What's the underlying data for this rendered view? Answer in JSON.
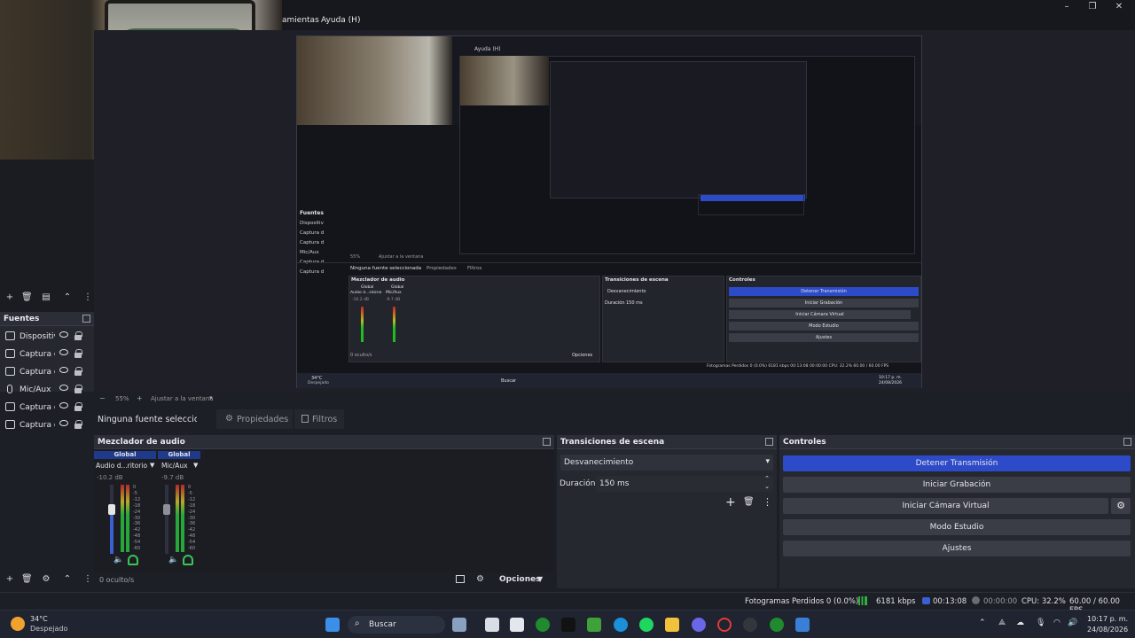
{
  "menu": {
    "herramientas": "amientas",
    "ayuda": "Ayuda (H)"
  },
  "nested": {
    "menu_ayuda": "Ayuda (H)",
    "fuentes_title": "Fuentes",
    "sources": [
      "Dispositiv",
      "Captura d",
      "Captura d",
      "Mic/Aux",
      "Captura d",
      "Captura d"
    ],
    "ninguna": "Ninguna fuente seleccionada",
    "propiedades": "Propiedades",
    "filtros": "Filtros",
    "mezclador": "Mezclador de audio",
    "transiciones": "Transiciones de escena",
    "controles": "Controles",
    "global1": "Global",
    "global2": "Global",
    "ch1": "Audio d...sitorio",
    "ch2": "Mic/Aux",
    "db1": "-10.2 dB",
    "db2": "-9.7 dB",
    "desvanecimiento": "Desvanecimiento",
    "duracion": "Duración",
    "duracion_value": "150 ms",
    "detener": "Detener Transmisión",
    "iniciar_grab": "Iniciar Grabación",
    "camara_virtual": "Iniciar Cámara Virtual",
    "modo_estudio": "Modo Estudio",
    "ajustes": "Ajustes",
    "ocultos": "0 oculto/s",
    "opciones": "Opciones",
    "zoom": "55%",
    "ajustar": "Ajustar a la ventana",
    "status": "Fotogramas Perdidos 0 (0.0%)   6181 kbps   00:13:08   00:00:00   CPU: 32.2%   60.00 / 60.00 FPS",
    "weather": "34°C",
    "weather_desc": "Despejado",
    "buscar": "Buscar",
    "clock": "10:17 p. m.",
    "date": "24/08/2026"
  },
  "sources_panel": {
    "title": "Fuentes",
    "items": [
      {
        "label": "Dispositiv",
        "icon": "camera-icon"
      },
      {
        "label": "Captura d",
        "icon": "window-icon"
      },
      {
        "label": "Captura d",
        "icon": "window-icon"
      },
      {
        "label": "Mic/Aux",
        "icon": "mic-icon"
      },
      {
        "label": "Captura d",
        "icon": "window-icon"
      },
      {
        "label": "Captura d",
        "icon": "window-icon"
      }
    ]
  },
  "preview_toolbar": {
    "zoom": "55%",
    "fit": "Ajustar a la ventana"
  },
  "properties_bar": {
    "no_source": "Ninguna fuente seleccionada",
    "propiedades": "Propiedades",
    "filtros": "Filtros"
  },
  "mixer": {
    "title": "Mezclador de audio",
    "channels": [
      {
        "scope": "Global",
        "name": "Audio d...ritorio",
        "db": "-10.2 dB",
        "level": 0.5
      },
      {
        "scope": "Global",
        "name": "Mic/Aux",
        "db": "-9.7 dB",
        "level": 0.6
      }
    ],
    "scale": [
      "0",
      "-5",
      "-12",
      "-18",
      "-24",
      "-30",
      "-36",
      "-42",
      "-48",
      "-54",
      "-60"
    ],
    "hidden": "0 oculto/s",
    "options": "Opciones"
  },
  "transitions": {
    "title": "Transiciones de escena",
    "selected": "Desvanecimiento",
    "duration_label": "Duración",
    "duration_value": "150 ms"
  },
  "controls": {
    "title": "Controles",
    "stop_stream": "Detener Transmisión",
    "start_record": "Iniciar Grabación",
    "virtual_cam": "Iniciar Cámara Virtual",
    "studio": "Modo Estudio",
    "settings": "Ajustes"
  },
  "status": {
    "dropped": "Fotogramas Perdidos 0 (0.0%)",
    "bitrate": "6181 kbps",
    "live_time": "00:13:08",
    "rec_time": "00:00:00",
    "cpu": "CPU: 32.2%",
    "fps": "60.00 / 60.00 FPS"
  },
  "taskbar": {
    "temp": "34°C",
    "weather": "Despejado",
    "search": "Buscar",
    "time": "10:17 p. m.",
    "date": "24/08/2026"
  },
  "colors": {
    "accent": "#2d4ac9",
    "panel": "#26282f",
    "bg": "#1d1f26"
  }
}
